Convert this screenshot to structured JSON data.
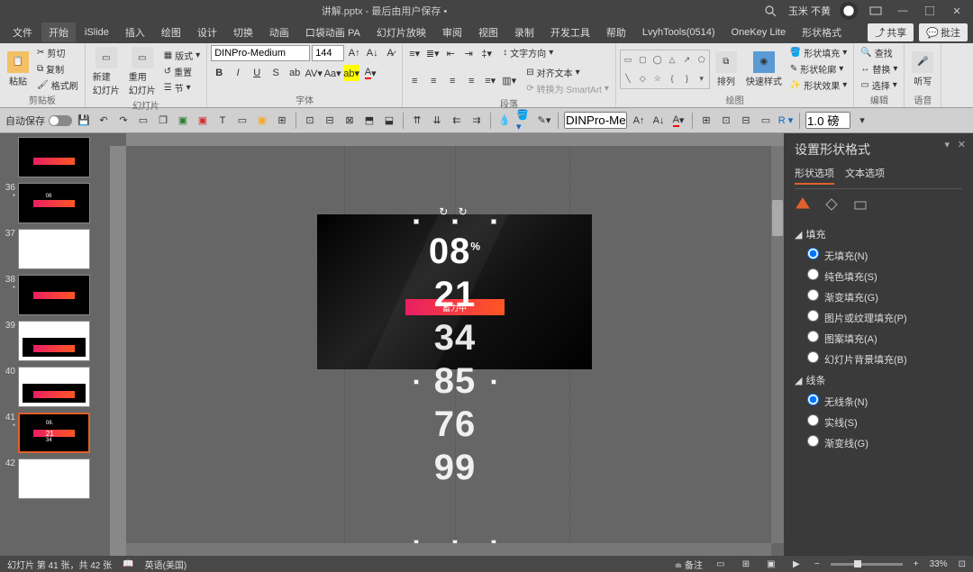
{
  "titlebar": {
    "filename": "讲解.pptx - 最后由用户保存 •",
    "user": "玉米 不黄"
  },
  "menubar": {
    "items": [
      "文件",
      "开始",
      "iSlide",
      "插入",
      "绘图",
      "设计",
      "切换",
      "动画",
      "口袋动画 PA",
      "幻灯片放映",
      "审阅",
      "视图",
      "录制",
      "开发工具",
      "帮助",
      "LvyhTools(0514)",
      "OneKey Lite",
      "形状格式"
    ],
    "active_index": 1,
    "share": "共享",
    "comment": "批注"
  },
  "ribbon": {
    "clipboard": {
      "paste": "粘贴",
      "cut": "剪切",
      "copy": "复制",
      "brush": "格式刷",
      "label": "剪贴板"
    },
    "slides": {
      "new": "新建\n幻灯片",
      "reuse": "重用\n幻灯片",
      "layout": "版式",
      "reset": "重置",
      "section": "节",
      "label": "幻灯片"
    },
    "font": {
      "name": "DINPro-Medium",
      "size": "144",
      "label": "字体"
    },
    "paragraph": {
      "direction": "文字方向",
      "align": "对齐文本",
      "smartart": "转换为 SmartArt",
      "label": "段落"
    },
    "drawing": {
      "arrange": "排列",
      "quick": "快速样式",
      "fill": "形状填充",
      "outline": "形状轮廓",
      "effects": "形状效果",
      "label": "绘图"
    },
    "editing": {
      "find": "查找",
      "replace": "替换",
      "select": "选择",
      "label": "编辑"
    },
    "voice": {
      "dictate": "听写",
      "label": "语音"
    }
  },
  "secondary": {
    "autosave": "自动保存",
    "font2": "DINPro-Med",
    "stroke": "1.0 磅"
  },
  "thumbs": [
    {
      "num": "",
      "dark": true,
      "bar": true
    },
    {
      "num": "36",
      "star": true,
      "dark": true,
      "bar": true,
      "nums": true
    },
    {
      "num": "37",
      "dark": false
    },
    {
      "num": "38",
      "star": true,
      "dark": true,
      "bar": true
    },
    {
      "num": "39",
      "dark": false,
      "complex": true
    },
    {
      "num": "40",
      "dark": false,
      "complex2": true
    },
    {
      "num": "41",
      "star": true,
      "dark": true,
      "bar": true,
      "active": true,
      "nums2": true
    },
    {
      "num": "42",
      "dark": false
    }
  ],
  "stage": {
    "badge": "蓄力中",
    "numbers": [
      "08",
      "21",
      "34",
      "85",
      "76",
      "99"
    ],
    "pct": "%"
  },
  "format_panel": {
    "title": "设置形状格式",
    "tab1": "形状选项",
    "tab2": "文本选项",
    "fill_head": "填充",
    "fill_opts": [
      "无填充(N)",
      "纯色填充(S)",
      "渐变填充(G)",
      "图片或纹理填充(P)",
      "图案填充(A)",
      "幻灯片背景填充(B)"
    ],
    "line_head": "线条",
    "line_opts": [
      "无线条(N)",
      "实线(S)",
      "渐变线(G)"
    ]
  },
  "statusbar": {
    "slide_info": "幻灯片 第 41 张，共 42 张",
    "lang": "英语(美国)",
    "notes": "备注",
    "zoom": "33%"
  }
}
